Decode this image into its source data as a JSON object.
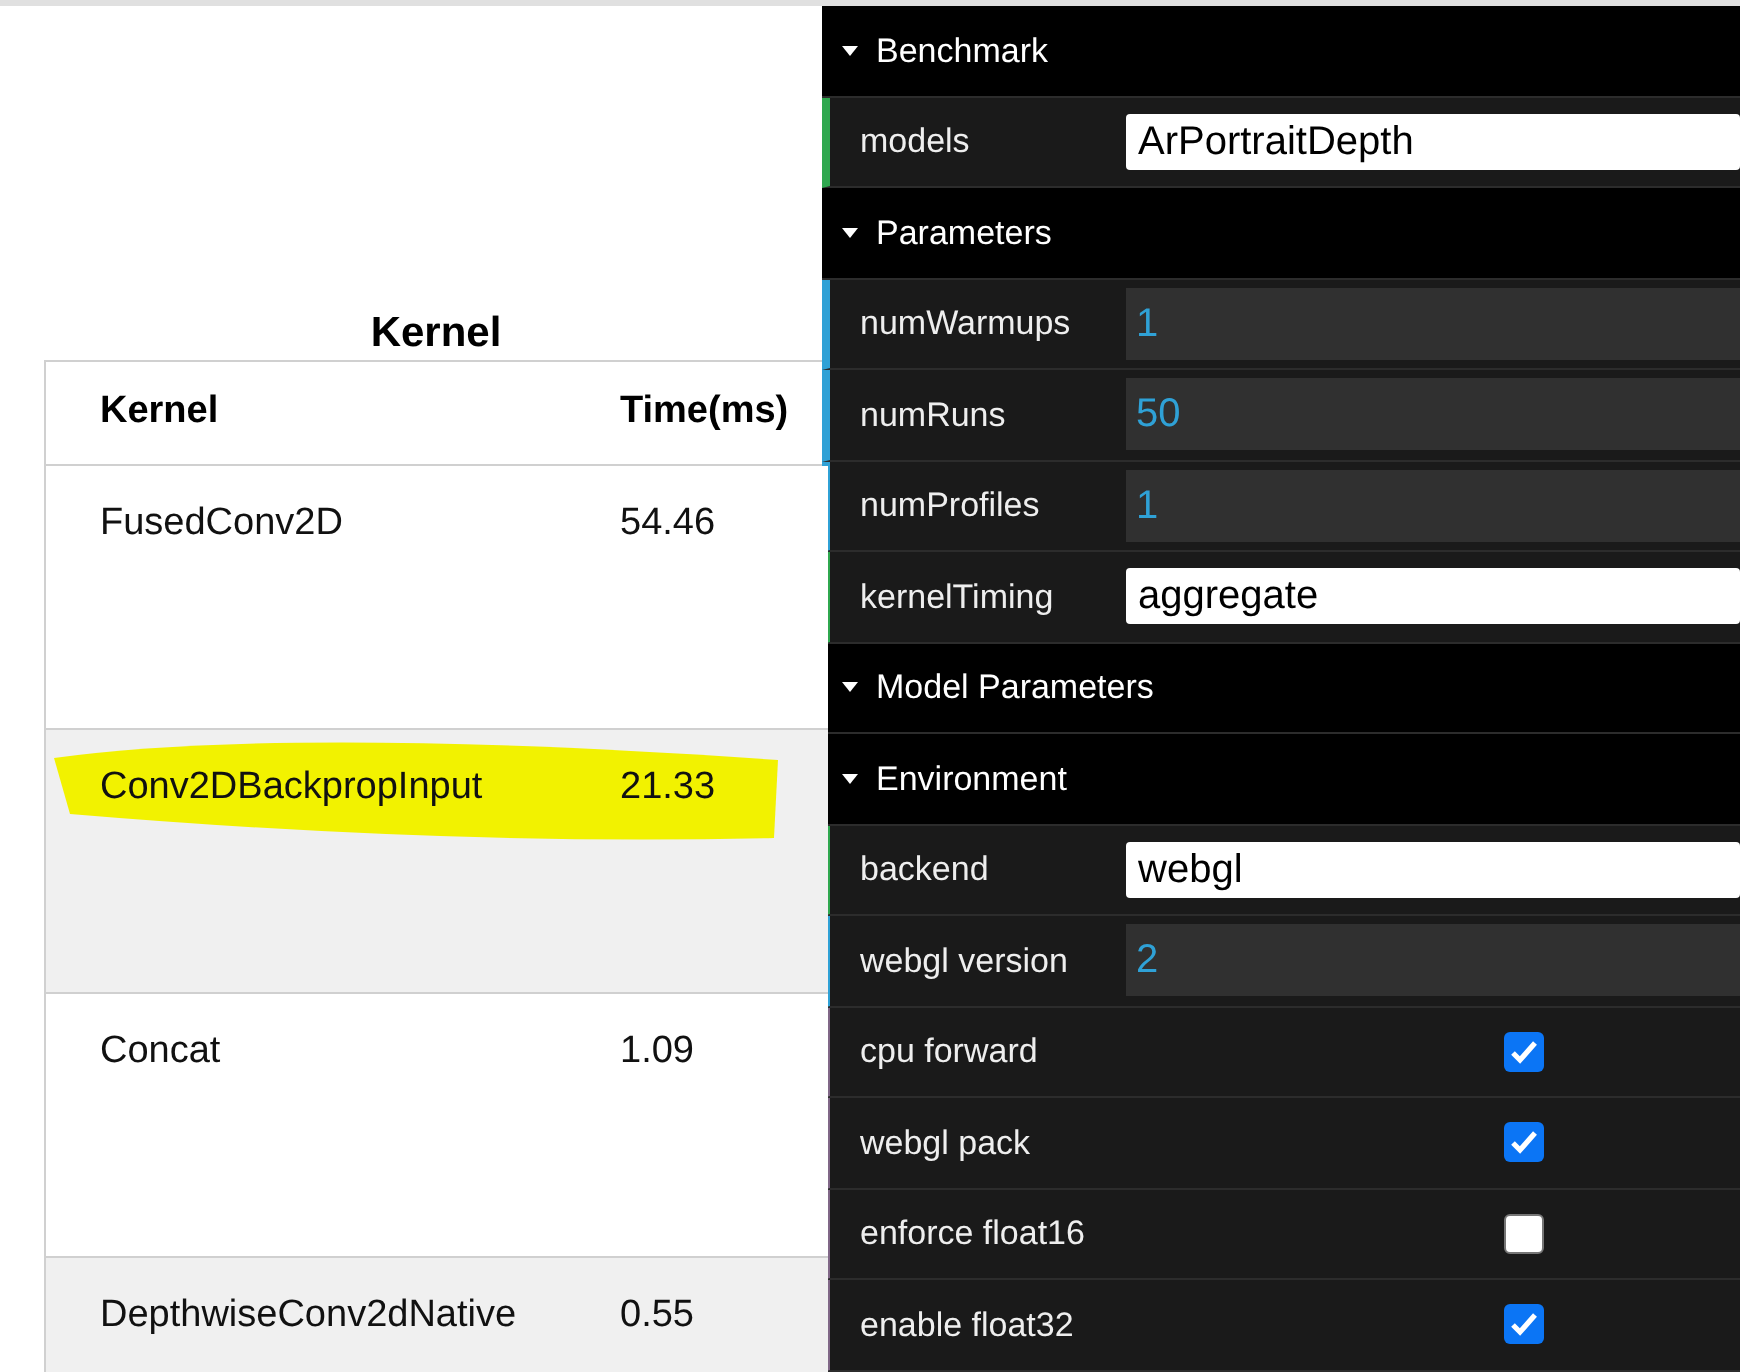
{
  "table": {
    "title": "Kernel",
    "columns": [
      "Kernel",
      "Time(ms)"
    ],
    "rows": [
      {
        "cells": [
          "FusedConv2D",
          "54.46"
        ],
        "highlighted": false
      },
      {
        "cells": [
          "Conv2DBackpropInput",
          "21.33"
        ],
        "highlighted": true
      },
      {
        "cells": [
          "Concat",
          "1.09"
        ],
        "highlighted": false
      },
      {
        "cells": [
          "DepthwiseConv2dNative",
          "0.55"
        ],
        "highlighted": false
      }
    ]
  },
  "panel": {
    "folders": [
      {
        "title": "Benchmark",
        "expanded": true,
        "controls": [
          {
            "kind": "string",
            "label": "models",
            "value": "ArPortraitDepth"
          }
        ]
      },
      {
        "title": "Parameters",
        "expanded": true,
        "controls": [
          {
            "kind": "number",
            "label": "numWarmups",
            "value": "1"
          },
          {
            "kind": "number",
            "label": "numRuns",
            "value": "50"
          },
          {
            "kind": "number",
            "label": "numProfiles",
            "value": "1"
          },
          {
            "kind": "string",
            "label": "kernelTiming",
            "value": "aggregate"
          }
        ]
      },
      {
        "title": "Model Parameters",
        "expanded": true
      },
      {
        "title": "Environment",
        "expanded": true,
        "controls": [
          {
            "kind": "string",
            "label": "backend",
            "value": "webgl"
          },
          {
            "kind": "number",
            "label": "webgl version",
            "value": "2"
          },
          {
            "kind": "boolean",
            "label": "cpu forward",
            "checked": true
          },
          {
            "kind": "boolean",
            "label": "webgl pack",
            "checked": true
          },
          {
            "kind": "boolean",
            "label": "enforce float16",
            "checked": false
          },
          {
            "kind": "boolean",
            "label": "enable float32",
            "checked": true
          }
        ]
      }
    ]
  }
}
